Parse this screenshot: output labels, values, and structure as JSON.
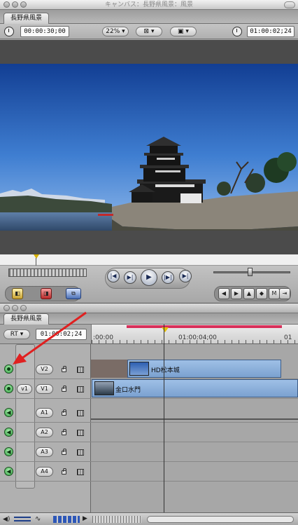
{
  "canvas": {
    "window_title": "キャンバス：長野県風景：風景",
    "tab": "長野県風景",
    "duration_tc": "00:00:30;00",
    "zoom": "22%",
    "current_tc": "01:00:02;24"
  },
  "timeline": {
    "tab": "長野県風景",
    "rt_label": "RT",
    "current_tc": "01:00:02;24",
    "ruler_labels": [
      ":00:00",
      "01:00:04;00",
      "01"
    ],
    "video_tracks": [
      {
        "label": "V2",
        "source": "",
        "clip": "HD松本城"
      },
      {
        "label": "V1",
        "source": "v1",
        "clip": "金口水門"
      }
    ],
    "audio_tracks": [
      {
        "label": "A1"
      },
      {
        "label": "A2"
      },
      {
        "label": "A3"
      },
      {
        "label": "A4"
      }
    ]
  },
  "colors": {
    "clip_blue": "#8fb3df",
    "annotation_arrow": "#e02020",
    "in_out_bar": "#d8305a"
  }
}
